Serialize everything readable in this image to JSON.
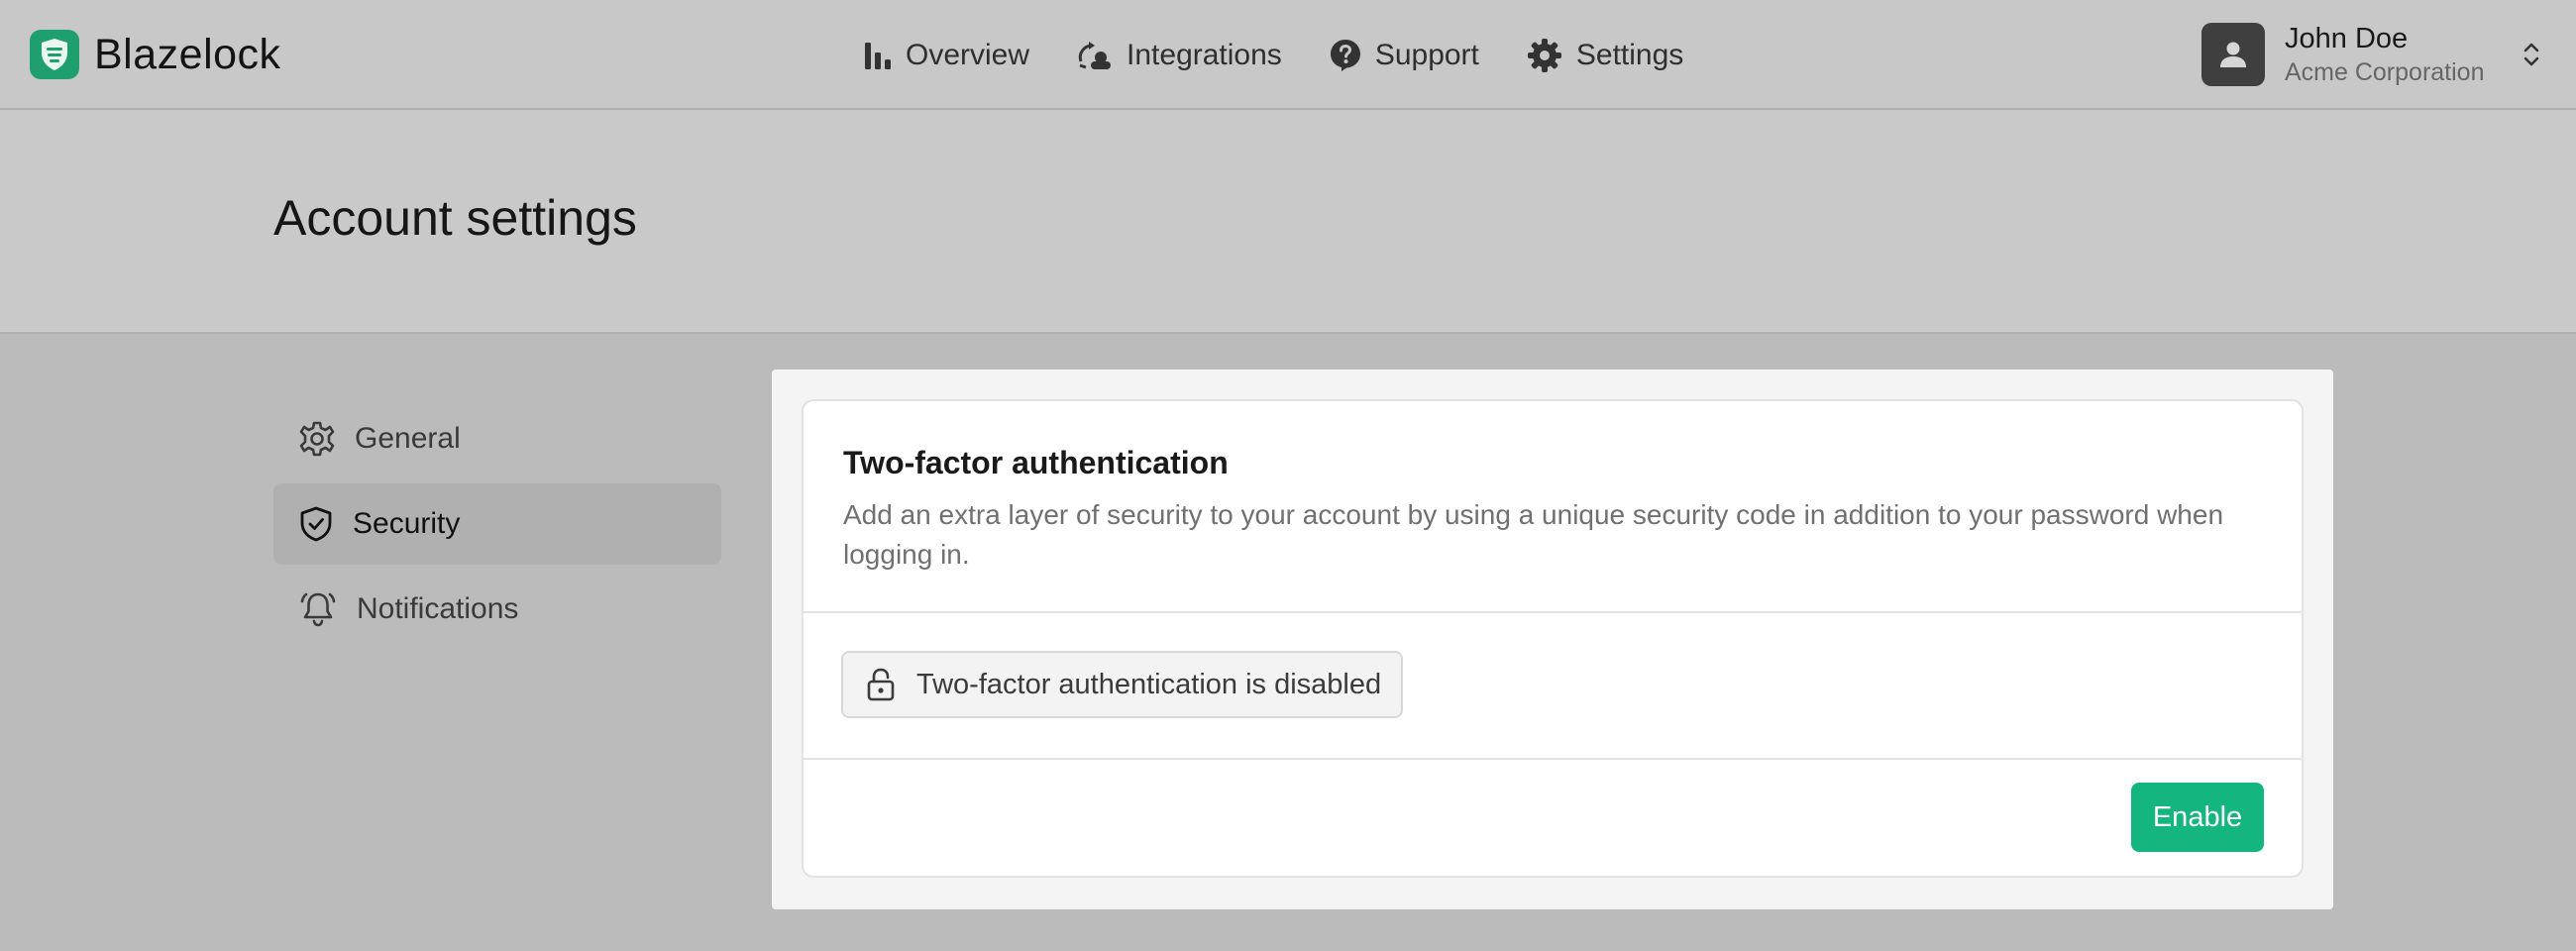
{
  "brand": {
    "name": "Blazelock",
    "accent": "#1f9e6e"
  },
  "nav": {
    "items": [
      {
        "label": "Overview",
        "icon": "bar-chart-icon"
      },
      {
        "label": "Integrations",
        "icon": "integrations-icon"
      },
      {
        "label": "Support",
        "icon": "help-bubble-icon"
      },
      {
        "label": "Settings",
        "icon": "gear-icon"
      }
    ]
  },
  "user": {
    "name": "John Doe",
    "organization": "Acme Corporation",
    "icon": "user-avatar-icon"
  },
  "page": {
    "title": "Account settings"
  },
  "sidebar": {
    "items": [
      {
        "label": "General",
        "icon": "gear-icon",
        "active": false
      },
      {
        "label": "Security",
        "icon": "shield-check-icon",
        "active": true
      },
      {
        "label": "Notifications",
        "icon": "bell-icon",
        "active": false
      }
    ]
  },
  "two_factor": {
    "title": "Two-factor authentication",
    "description": "Add an extra layer of security to your account by using a unique security code in addition to your password when logging in.",
    "status": "Two-factor authentication is disabled",
    "status_icon": "lock-icon",
    "action_label": "Enable",
    "action_color": "#14b57f"
  }
}
